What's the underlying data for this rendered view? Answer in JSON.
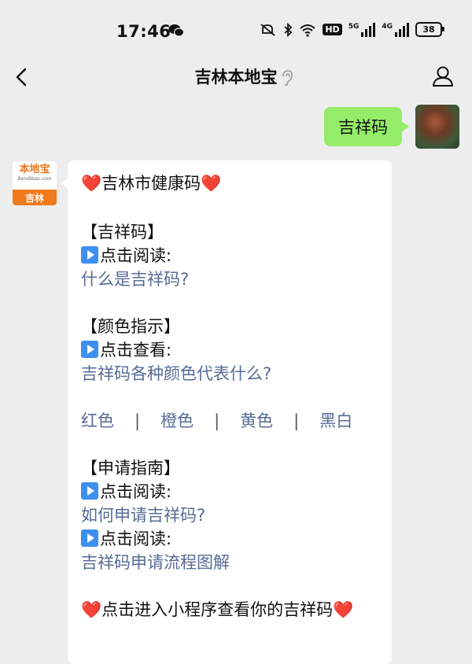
{
  "status_bar": {
    "time": "17:46",
    "signal_1_label": "5G",
    "signal_2_label": "4G",
    "hd_label": "HD",
    "battery": "38"
  },
  "header": {
    "title": "吉林本地宝"
  },
  "outgoing": {
    "text": "吉祥码"
  },
  "incoming": {
    "avatar_logo": "本地宝",
    "avatar_domain": "Bendibao.com",
    "avatar_city": "吉林",
    "heading": "吉林市健康码",
    "section1_title": "【吉祥码】",
    "section1_action": "点击阅读:",
    "section1_link": "什么是吉祥码?",
    "section2_title": "【颜色指示】",
    "section2_action": "点击查看:",
    "section2_link": "吉祥码各种颜色代表什么?",
    "colors": [
      "红色",
      "橙色",
      "黄色",
      "黑白"
    ],
    "separator": "|",
    "section3_title": "【申请指南】",
    "section3_action1": "点击阅读:",
    "section3_link1": "如何申请吉祥码?",
    "section3_action2": "点击阅读:",
    "section3_link2": "吉祥码申请流程图解",
    "footer": "点击进入小程序查看你的吉祥码",
    "heart": "❤️"
  },
  "colors": {
    "link": "#576b95",
    "bubble_out": "#95ec69",
    "background": "#ededed",
    "play_icon": "#3d8ff0"
  }
}
